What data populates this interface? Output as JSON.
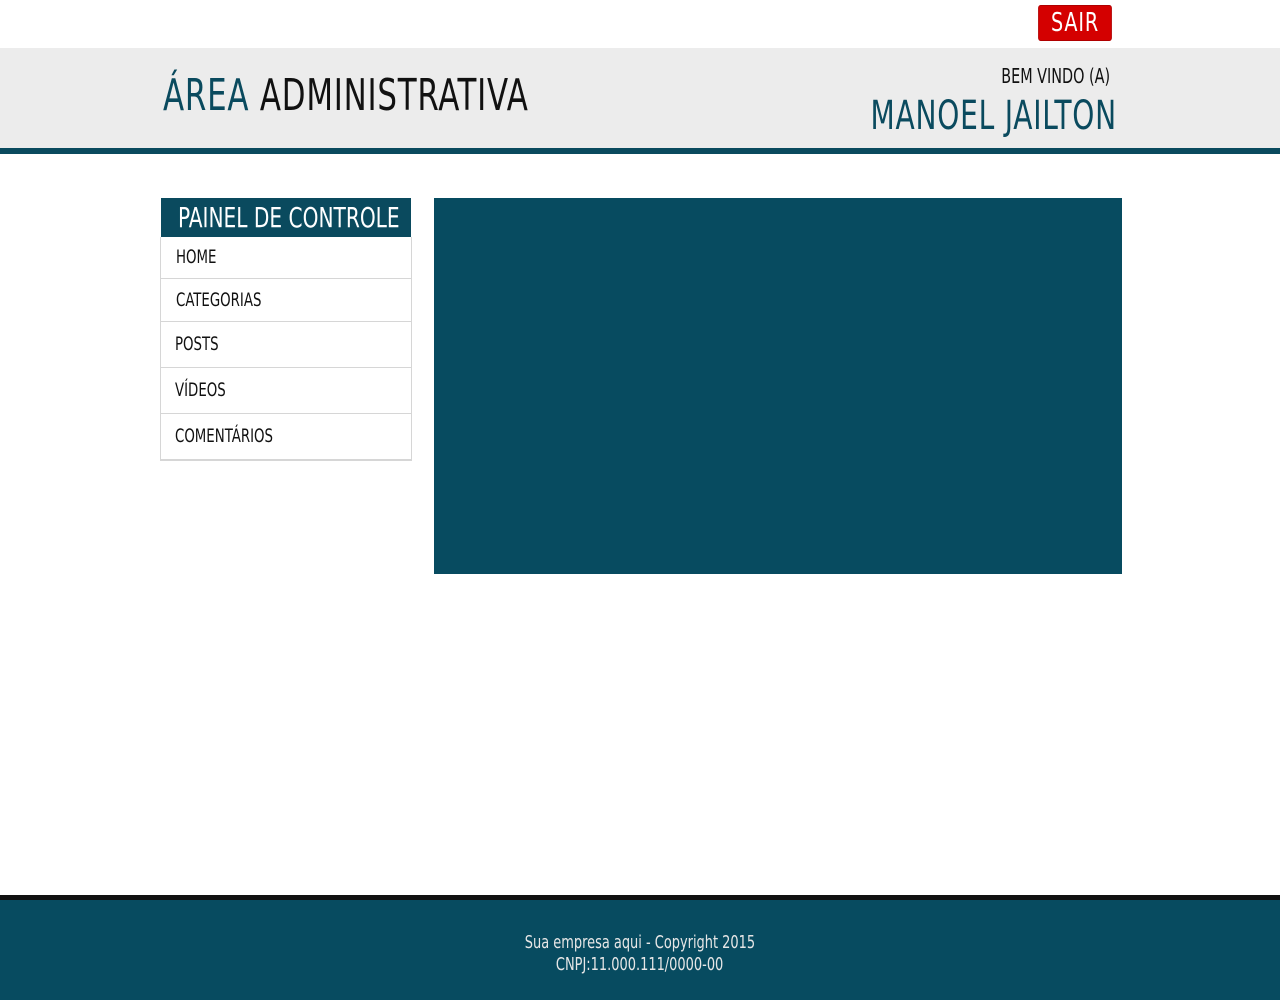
{
  "topbar": {
    "logout_label": "SAIR"
  },
  "header": {
    "title_accent": "ÁREA",
    "title_rest": "ADMINISTRATIVA",
    "welcome_label": "BEM VINDO (A)",
    "user_name": "MANOEL JAILTON"
  },
  "sidebar": {
    "title": "PAINEL DE CONTROLE",
    "items": [
      {
        "label": "HOME"
      },
      {
        "label": "CATEGORIAS"
      },
      {
        "label": "POSTS"
      },
      {
        "label": "VÍDEOS"
      },
      {
        "label": "COMENTÁRIOS"
      }
    ]
  },
  "footer": {
    "copyright": "Sua empresa aqui - Copyright 2015",
    "cnpj": "CNPJ:11.000.111/0000-00"
  },
  "colors": {
    "primary": "#074b60",
    "logout": "#d40000",
    "header_bg": "#ececec"
  }
}
